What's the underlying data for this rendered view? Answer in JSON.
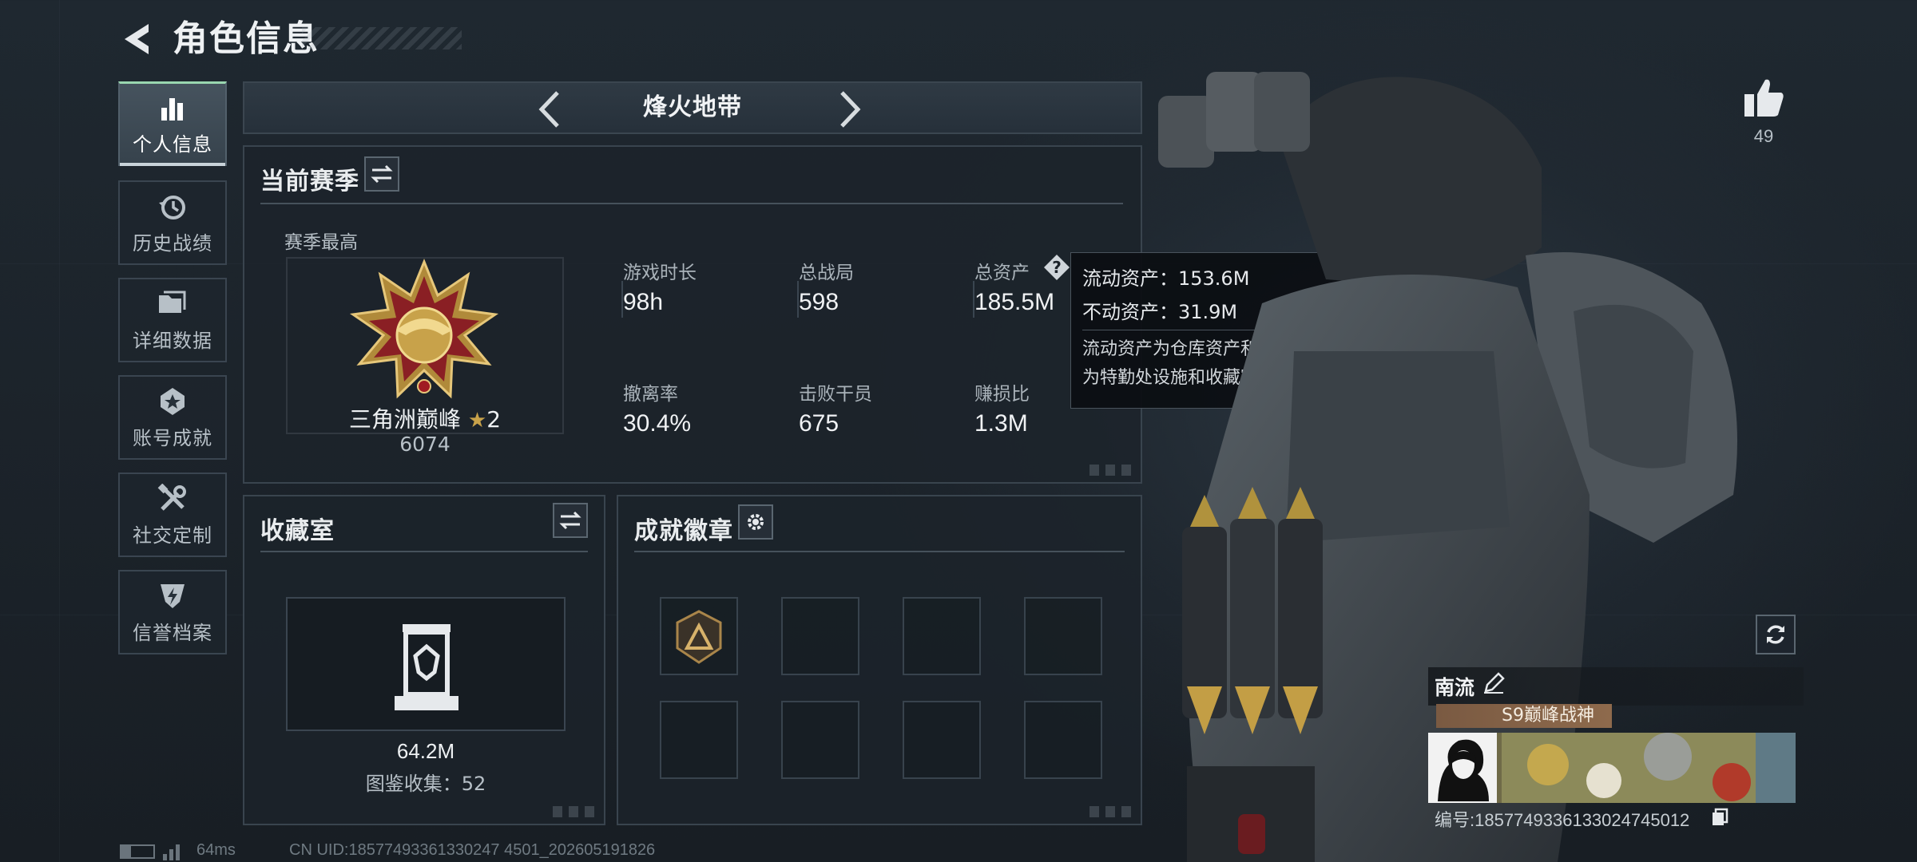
{
  "header": {
    "title": "角色信息"
  },
  "sidebar": {
    "items": [
      {
        "label": "个人信息",
        "icon": "bar-chart-icon"
      },
      {
        "label": "历史战绩",
        "icon": "history-icon"
      },
      {
        "label": "详细数据",
        "icon": "folder-icon"
      },
      {
        "label": "账号成就",
        "icon": "achievement-icon"
      },
      {
        "label": "社交定制",
        "icon": "tools-icon"
      },
      {
        "label": "信誉档案",
        "icon": "shield-bolt-icon"
      }
    ]
  },
  "mode_selector": {
    "current": "烽火地带"
  },
  "season": {
    "title": "当前赛季",
    "best_label": "赛季最高",
    "rank_name": "三角洲巅峰",
    "rank_stars": "2",
    "rank_points": "6074",
    "stats": [
      {
        "label": "游戏时长",
        "value": "98h"
      },
      {
        "label": "总战局",
        "value": "598"
      },
      {
        "label": "总资产",
        "value": "185.5M"
      },
      {
        "label": "撤离率",
        "value": "30.4%"
      },
      {
        "label": "击败干员",
        "value": "675"
      },
      {
        "label": "赚损比",
        "value": "1.3M"
      }
    ]
  },
  "tooltip": {
    "liquid": "流动资产：153.6M",
    "fixed": "不动资产：31.9M",
    "note_line1": "流动资产为仓库资产和哈夫币，不动资产",
    "note_line2": "为特勤处设施和收藏室设施"
  },
  "collection": {
    "title": "收藏室",
    "value": "64.2M",
    "count": "图鉴收集：52"
  },
  "badges": {
    "title": "成就徽章"
  },
  "likes": {
    "count": "49"
  },
  "profile": {
    "name": "南流",
    "title": "S9巅峰战神",
    "id": "编号:1857749336133024745012"
  },
  "status": {
    "ping": "64ms",
    "uid": "CN UID:18577493361330247 4501_202605191826"
  },
  "colors": {
    "accent_green": "#9ad7b0",
    "gold": "#c8a24a",
    "panel_border": "#39444e"
  }
}
